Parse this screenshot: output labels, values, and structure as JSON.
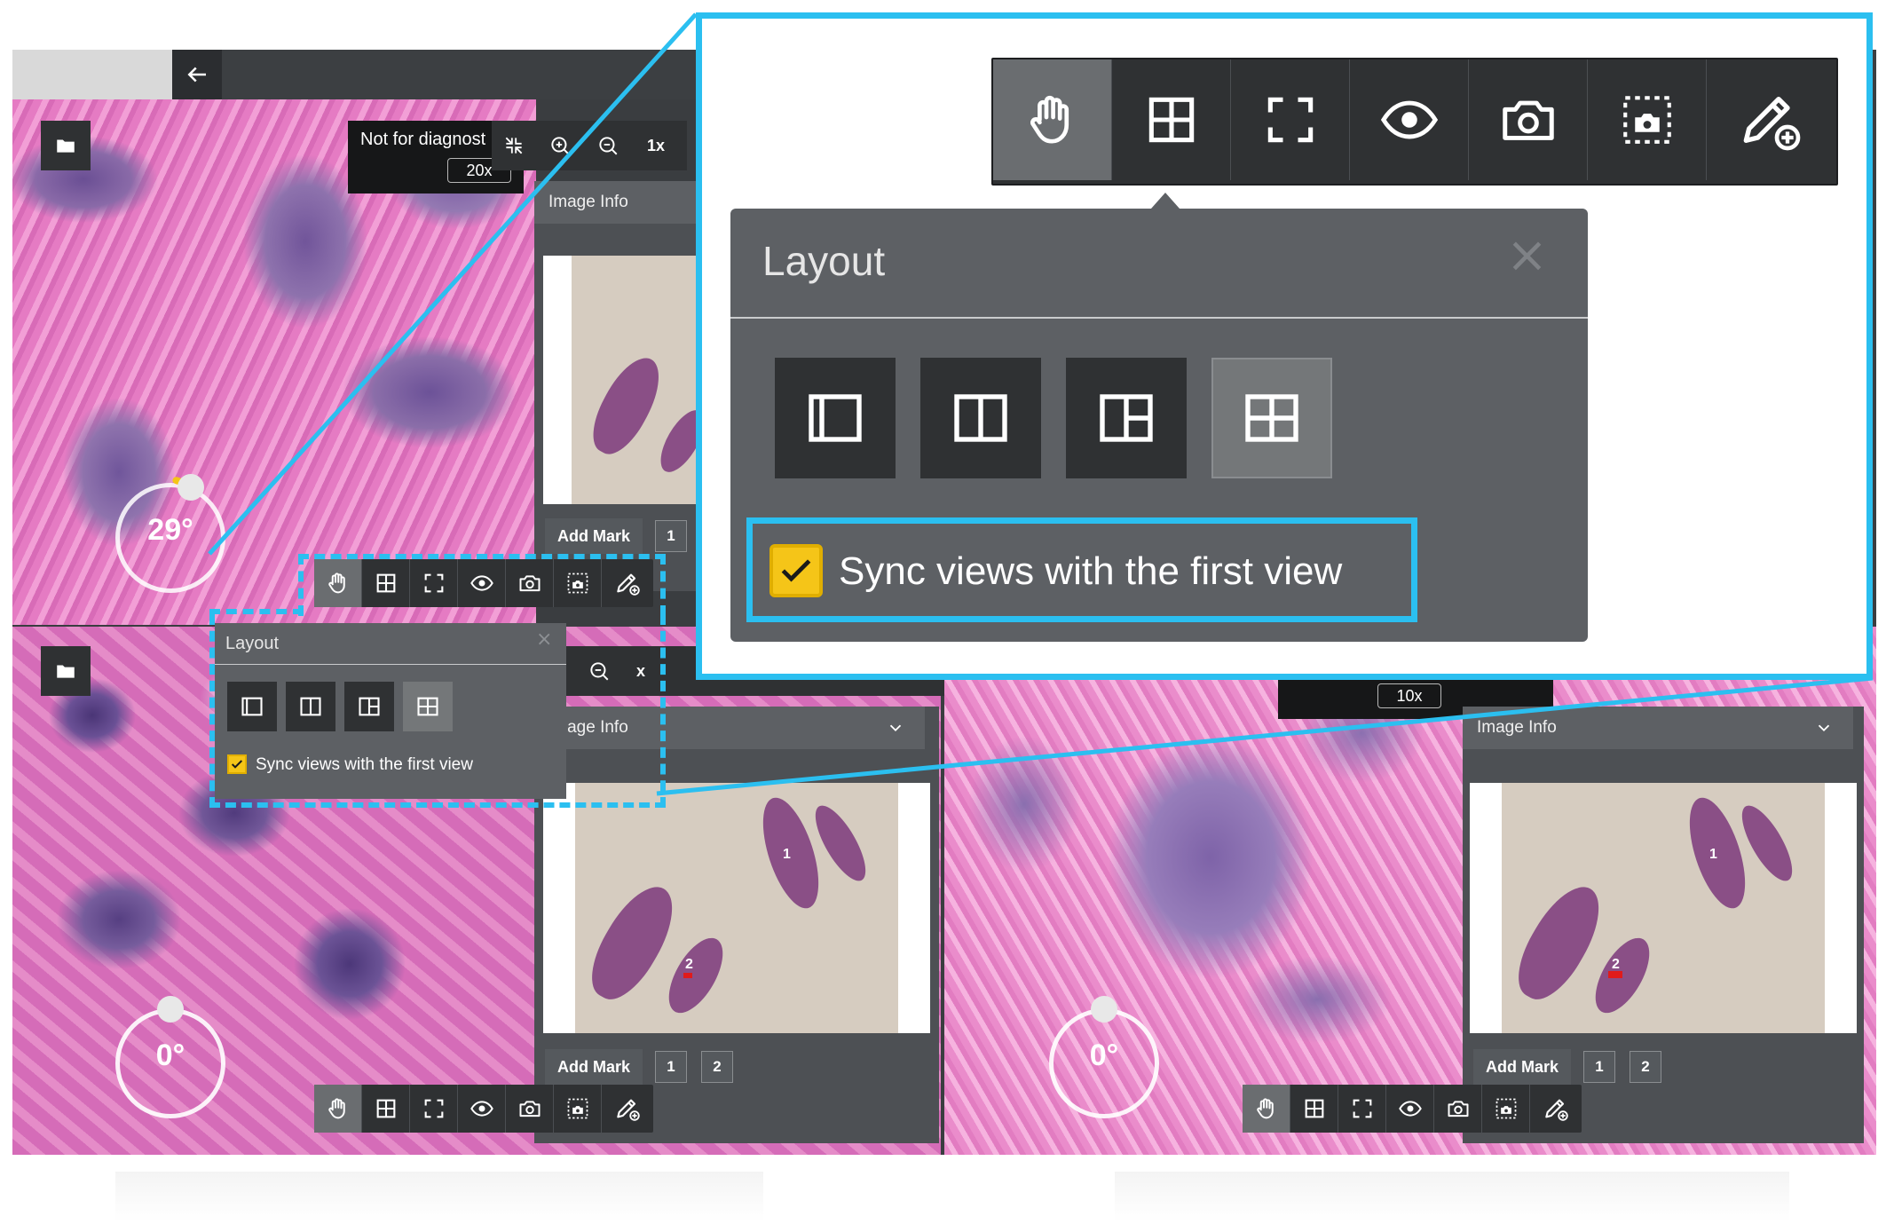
{
  "header": {
    "back_icon": "arrow-left-icon"
  },
  "top_left_view": {
    "disclaimer": "Not for diagnost",
    "magnification": "20x",
    "zoom_level": "1x",
    "rotation": "29°",
    "image_info_label": "Image Info"
  },
  "bottom_left_view": {
    "rotation": "0°",
    "image_info_label": "Image Info",
    "zoom_level": "x",
    "thumb_labels": [
      "1",
      "2"
    ],
    "add_mark_label": "Add Mark",
    "marks": [
      "1",
      "2"
    ]
  },
  "bottom_right_view": {
    "magnification": "10x",
    "rotation": "0°",
    "image_info_label": "Image Info",
    "thumb_labels": [
      "1",
      "2"
    ],
    "add_mark_label": "Add Mark",
    "marks": [
      "1",
      "2"
    ]
  },
  "top_right_view": {
    "add_mark_label": "Add Mark",
    "marks": [
      "1"
    ]
  },
  "toolbar": {
    "tools": [
      "hand-pan-icon",
      "layout-grid-icon",
      "fullscreen-icon",
      "eye-icon",
      "camera-icon",
      "region-snapshot-icon",
      "pencil-annotate-icon"
    ],
    "active_tool": "hand-pan-icon"
  },
  "layout_panel": {
    "title": "Layout",
    "close_icon": "close-icon",
    "options": [
      "layout-single-icon",
      "layout-two-columns-icon",
      "layout-three-split-icon",
      "layout-four-grid-icon"
    ],
    "selected_option": "layout-four-grid-icon",
    "sync_label": "Sync views with the first view",
    "sync_checked": true
  },
  "colors": {
    "highlight": "#2bbff0",
    "toolbar_bg": "#2f3133",
    "panel_bg": "#5d6064",
    "checkbox": "#f5c518"
  }
}
